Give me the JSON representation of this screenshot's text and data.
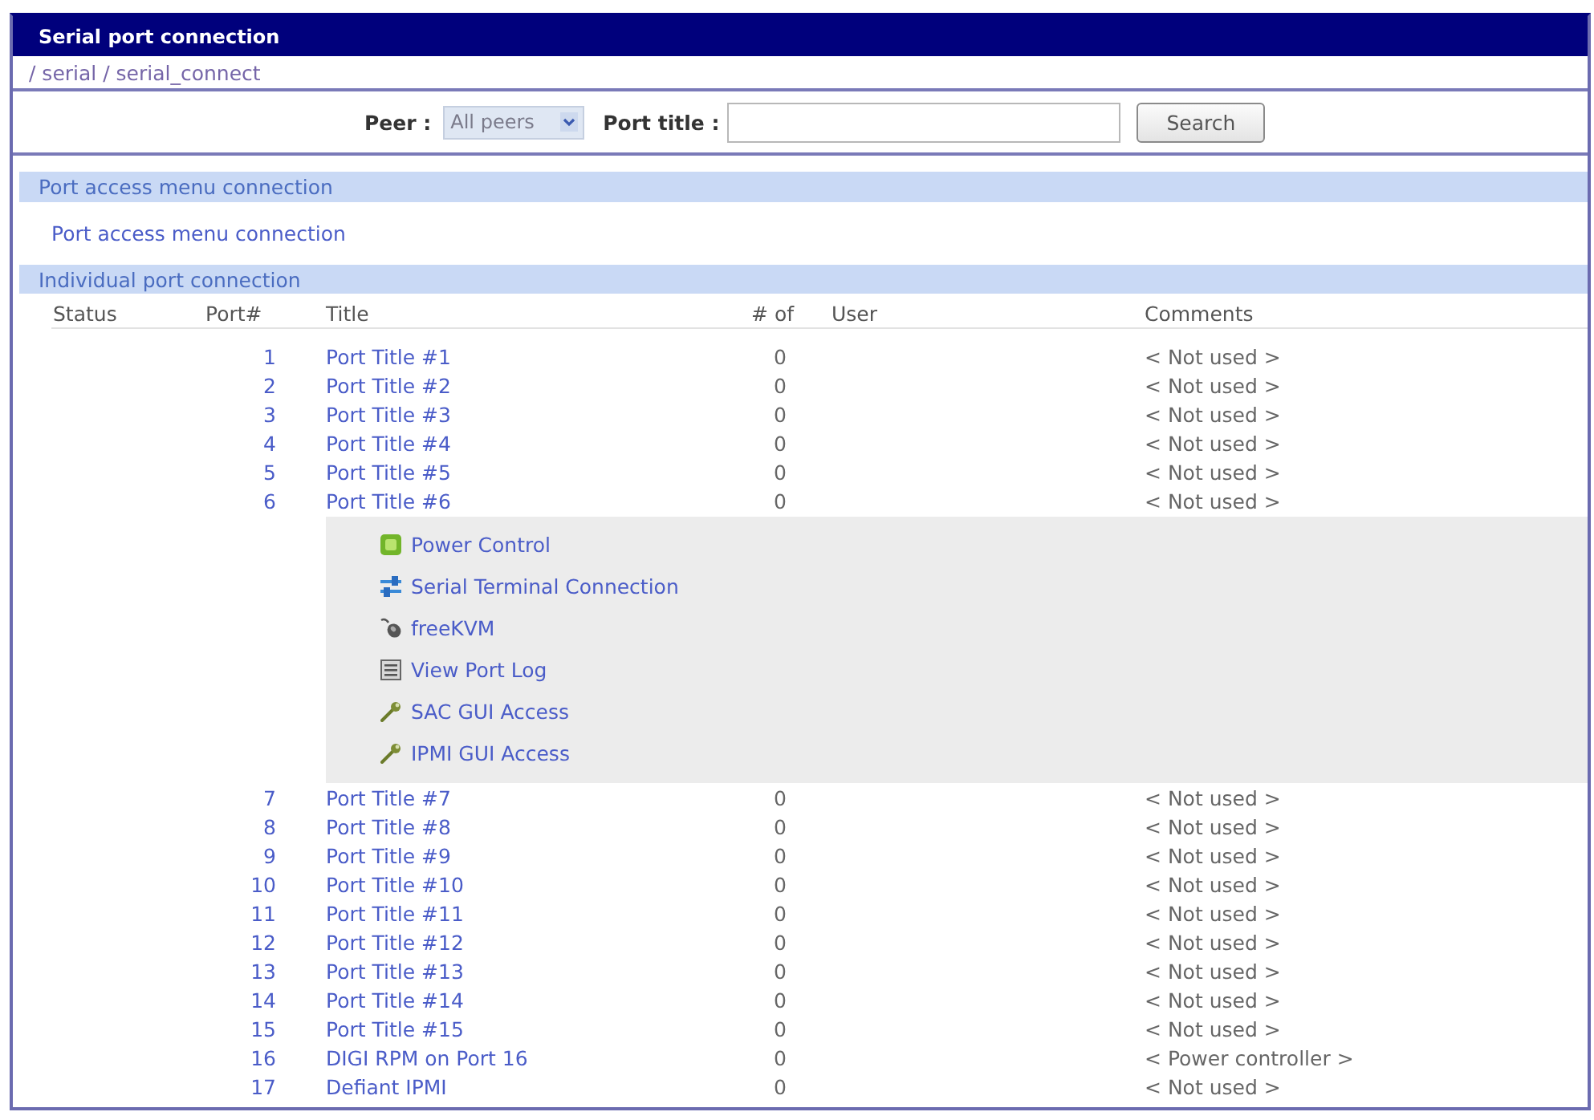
{
  "window": {
    "title": "Serial port connection"
  },
  "breadcrumb": "/ serial / serial_connect",
  "search": {
    "peer_label": "Peer :",
    "peer_value": "All peers",
    "port_title_label": "Port title :",
    "button": "Search"
  },
  "port_access_menu": {
    "heading": "Port access menu connection",
    "link": "Port access menu connection"
  },
  "individual_ports": {
    "heading": "Individual port connection",
    "columns": [
      "Status",
      "Port#",
      "Title",
      "# of",
      "User",
      "Comments"
    ],
    "rows": [
      {
        "port": "1",
        "title": "Port Title #1",
        "count": "0",
        "comment": "< Not used >"
      },
      {
        "port": "2",
        "title": "Port Title #2",
        "count": "0",
        "comment": "< Not used >"
      },
      {
        "port": "3",
        "title": "Port Title #3",
        "count": "0",
        "comment": "< Not used >"
      },
      {
        "port": "4",
        "title": "Port Title #4",
        "count": "0",
        "comment": "< Not used >"
      },
      {
        "port": "5",
        "title": "Port Title #5",
        "count": "0",
        "comment": "< Not used >"
      },
      {
        "port": "6",
        "title": "Port Title #6",
        "count": "0",
        "comment": "< Not used >",
        "menu": [
          {
            "kind": "power",
            "label": "Power Control"
          },
          {
            "kind": "terminal",
            "label": "Serial Terminal Connection"
          },
          {
            "kind": "kvm",
            "label": "freeKVM"
          },
          {
            "kind": "log",
            "label": "View Port Log"
          },
          {
            "kind": "gui",
            "label": "SAC GUI Access"
          },
          {
            "kind": "gui",
            "label": "IPMI GUI Access"
          }
        ]
      },
      {
        "port": "7",
        "title": "Port Title #7",
        "count": "0",
        "comment": "< Not used >"
      },
      {
        "port": "8",
        "title": "Port Title #8",
        "count": "0",
        "comment": "< Not used >"
      },
      {
        "port": "9",
        "title": "Port Title #9",
        "count": "0",
        "comment": "< Not used >"
      },
      {
        "port": "10",
        "title": "Port Title #10",
        "count": "0",
        "comment": "< Not used >"
      },
      {
        "port": "11",
        "title": "Port Title #11",
        "count": "0",
        "comment": "< Not used >"
      },
      {
        "port": "12",
        "title": "Port Title #12",
        "count": "0",
        "comment": "< Not used >"
      },
      {
        "port": "13",
        "title": "Port Title #13",
        "count": "0",
        "comment": "< Not used >"
      },
      {
        "port": "14",
        "title": "Port Title #14",
        "count": "0",
        "comment": "< Not used >"
      },
      {
        "port": "15",
        "title": "Port Title #15",
        "count": "0",
        "comment": "< Not used >"
      },
      {
        "port": "16",
        "title": "DIGI RPM on Port 16",
        "count": "0",
        "comment": "< Power controller >"
      },
      {
        "port": "17",
        "title": "Defiant IPMI",
        "count": "0",
        "comment": "< Not used >"
      }
    ]
  }
}
